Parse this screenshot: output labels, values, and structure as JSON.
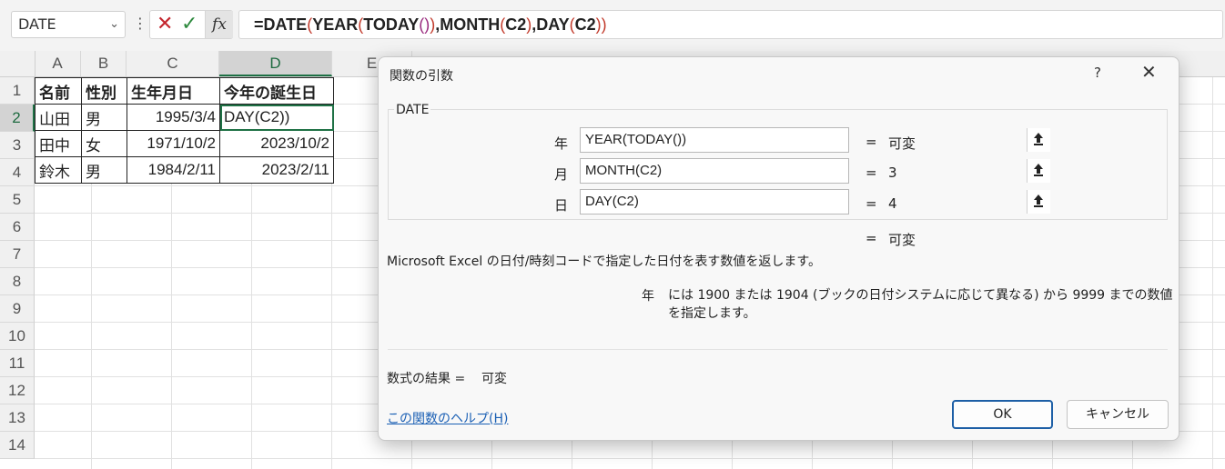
{
  "formula_bar": {
    "name_box": "DATE",
    "cancel_icon": "close-icon",
    "enter_icon": "check-icon",
    "fx_label": "fx",
    "formula_parts": [
      {
        "t": "=DATE",
        "c": "b"
      },
      {
        "t": "(",
        "c": "p"
      },
      {
        "t": "YEAR",
        "c": "b"
      },
      {
        "t": "(",
        "c": "p"
      },
      {
        "t": "TODAY",
        "c": "b"
      },
      {
        "t": "()",
        "c": "p2"
      },
      {
        "t": ")",
        "c": "p"
      },
      {
        "t": ",MONTH",
        "c": "b"
      },
      {
        "t": "(",
        "c": "p"
      },
      {
        "t": "C2",
        "c": "b"
      },
      {
        "t": ")",
        "c": "p"
      },
      {
        "t": ",DAY",
        "c": "b"
      },
      {
        "t": "(",
        "c": "p"
      },
      {
        "t": "C2",
        "c": "b"
      },
      {
        "t": "))",
        "c": "p"
      }
    ]
  },
  "sheet": {
    "active_column": "D",
    "active_row": "2",
    "columns": [
      "A",
      "B",
      "C",
      "D",
      "E"
    ],
    "rows": [
      "1",
      "2",
      "3",
      "4",
      "5",
      "6",
      "7",
      "8",
      "9",
      "10",
      "11",
      "12",
      "13",
      "14"
    ],
    "table": [
      [
        "名前",
        "性別",
        "生年月日",
        "今年の誕生日"
      ],
      [
        "山田",
        "男",
        "1995/3/4",
        "DAY(C2))"
      ],
      [
        "田中",
        "女",
        "1971/10/2",
        "2023/10/2"
      ],
      [
        "鈴木",
        "男",
        "1984/2/11",
        "2023/2/11"
      ]
    ]
  },
  "dialog": {
    "title": "関数の引数",
    "help_glyph": "?",
    "close_glyph": "✕",
    "function_name": "DATE",
    "args": [
      {
        "label": "年",
        "value": "YEAR(TODAY())",
        "eq": "=",
        "result": "可変"
      },
      {
        "label": "月",
        "value": "MONTH(C2)",
        "eq": "=",
        "result": "3"
      },
      {
        "label": "日",
        "value": "DAY(C2)",
        "eq": "=",
        "result": "4"
      }
    ],
    "total_eq": "=",
    "total_result": "可変",
    "description": "Microsoft Excel の日付/時刻コードで指定した日付を表す数値を返します。",
    "arg_desc_name": "年",
    "arg_desc_text": "には 1900 または 1904 (ブックの日付システムに応じて異なる) から 9999 までの数値を指定します。",
    "result_label": "数式の結果 =",
    "result_value": "可変",
    "help_link": "この関数のヘルプ(H)",
    "ok_label": "OK",
    "cancel_label": "キャンセル"
  }
}
